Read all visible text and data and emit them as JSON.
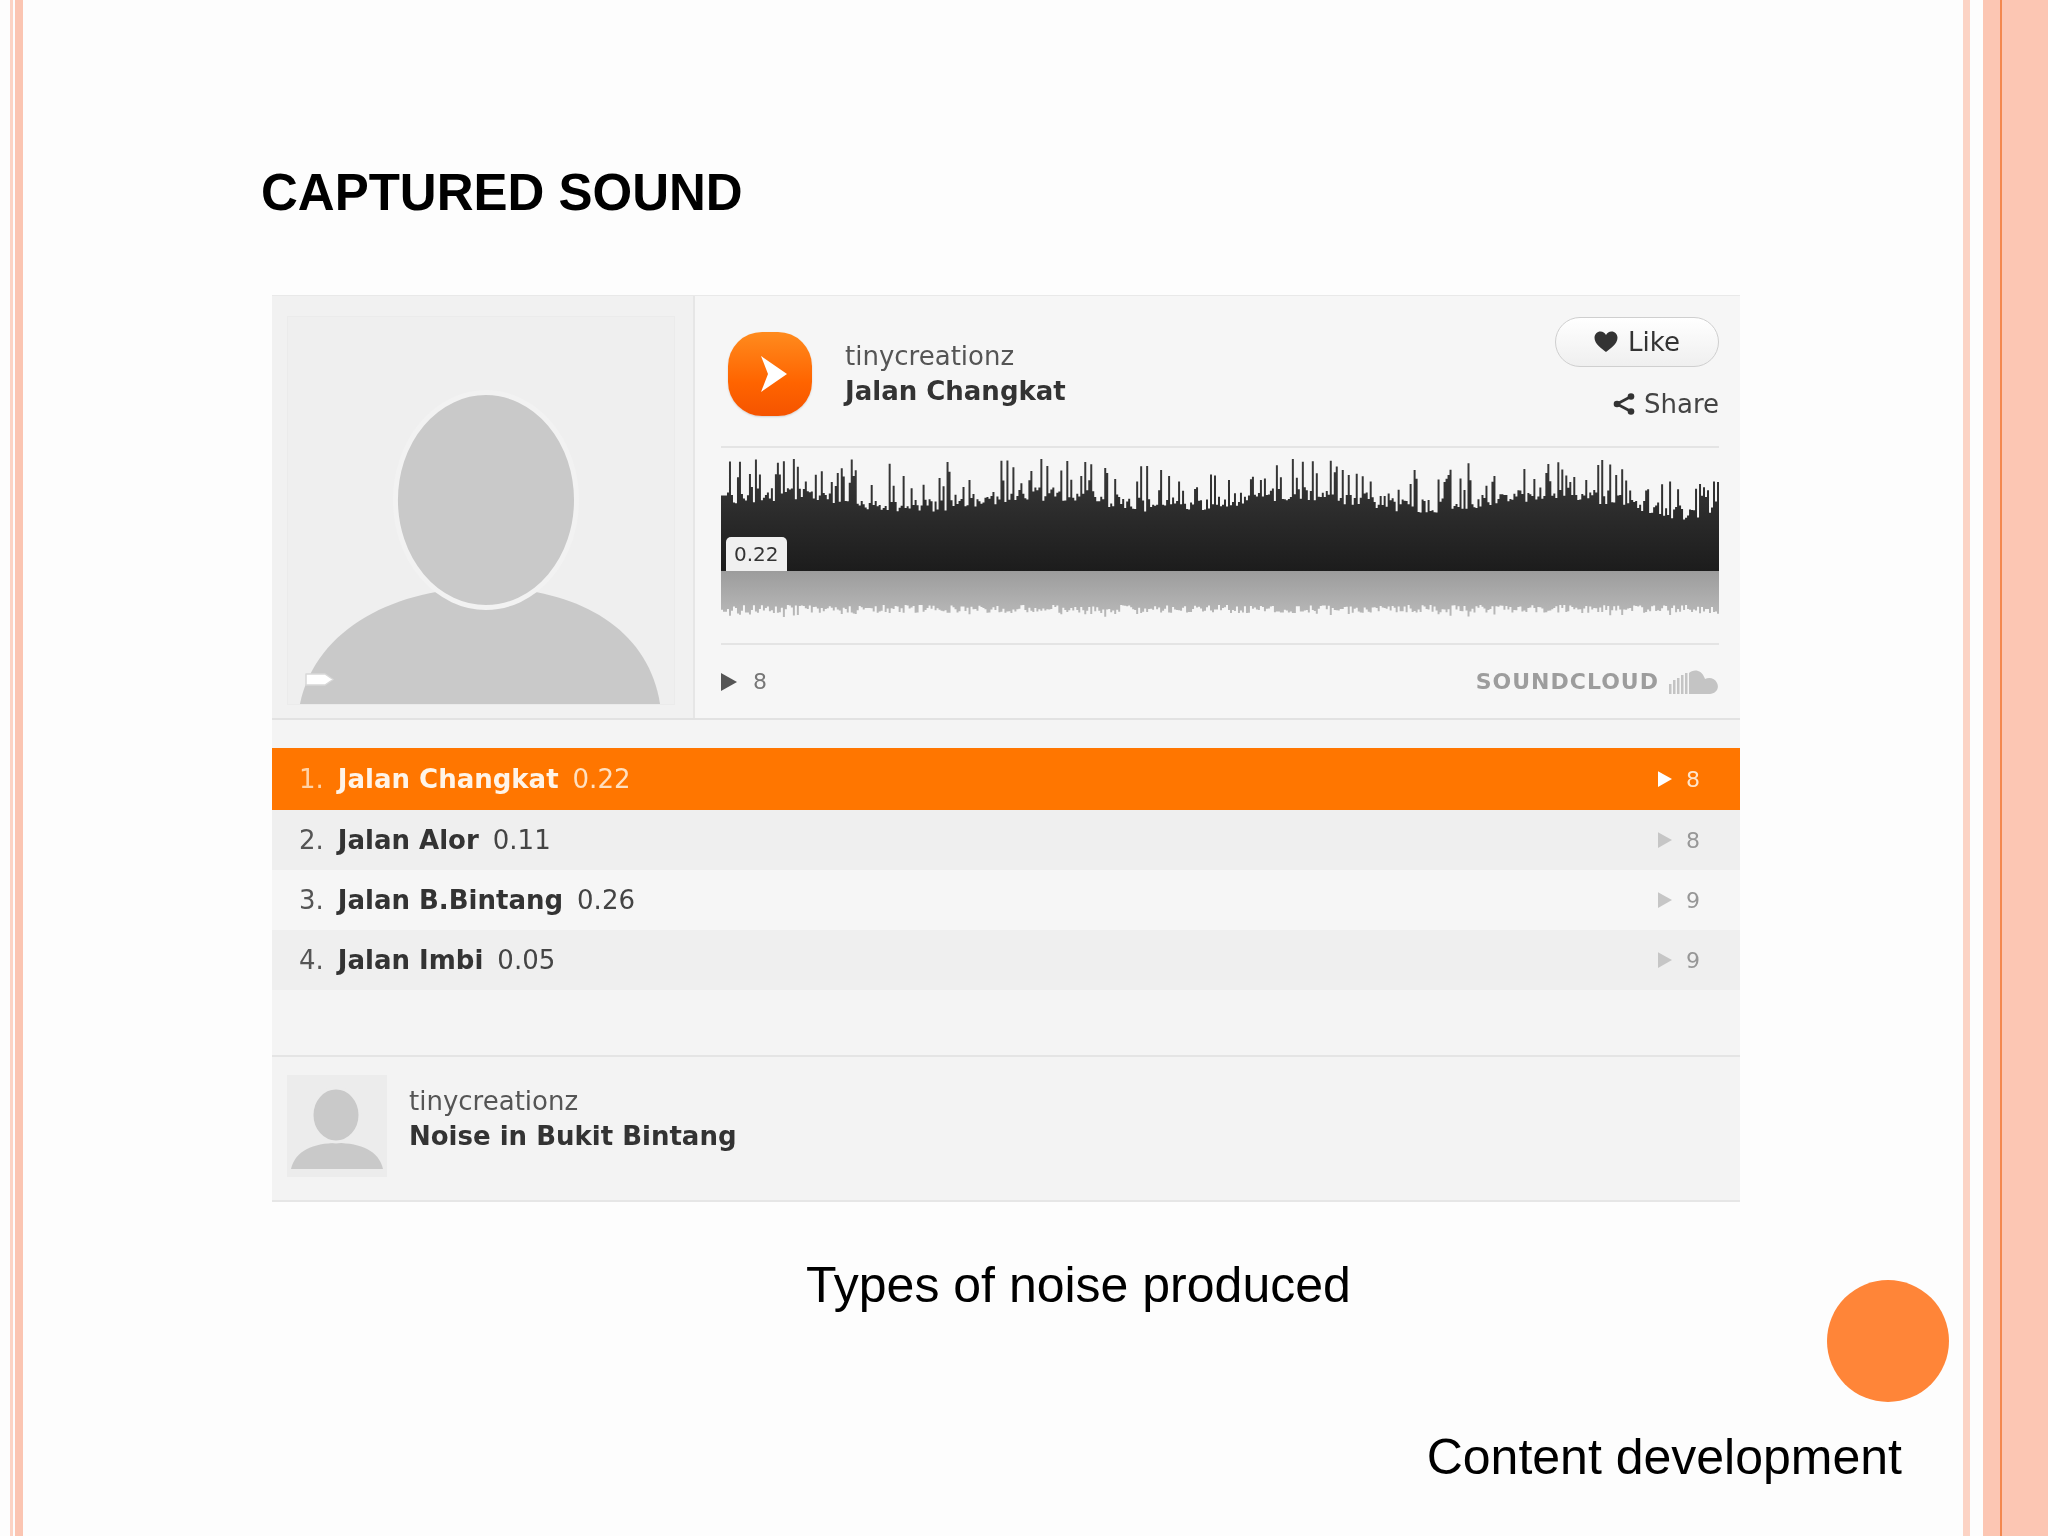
{
  "slide": {
    "title": "CAPTURED SOUND",
    "caption": "Types of noise produced",
    "footer": "Content development"
  },
  "player": {
    "user": "tinycreationz",
    "track_title": "Jalan Changkat",
    "like": "Like",
    "share": "Share",
    "waveform_time": "0.22",
    "play_count": "8",
    "brand": "SOUNDCLOUD"
  },
  "tracks": [
    {
      "number": "1.",
      "title": "Jalan Changkat",
      "duration": "0.22",
      "plays": "8",
      "selected": true
    },
    {
      "number": "2.",
      "title": "Jalan Alor",
      "duration": "0.11",
      "plays": "8",
      "selected": false
    },
    {
      "number": "3.",
      "title": "Jalan B.Bintang",
      "duration": "0.26",
      "plays": "9",
      "selected": false
    },
    {
      "number": "4.",
      "title": "Jalan Imbi",
      "duration": "0.05",
      "plays": "9",
      "selected": false
    }
  ],
  "set": {
    "user": "tinycreationz",
    "title": "Noise in Bukit Bintang"
  }
}
